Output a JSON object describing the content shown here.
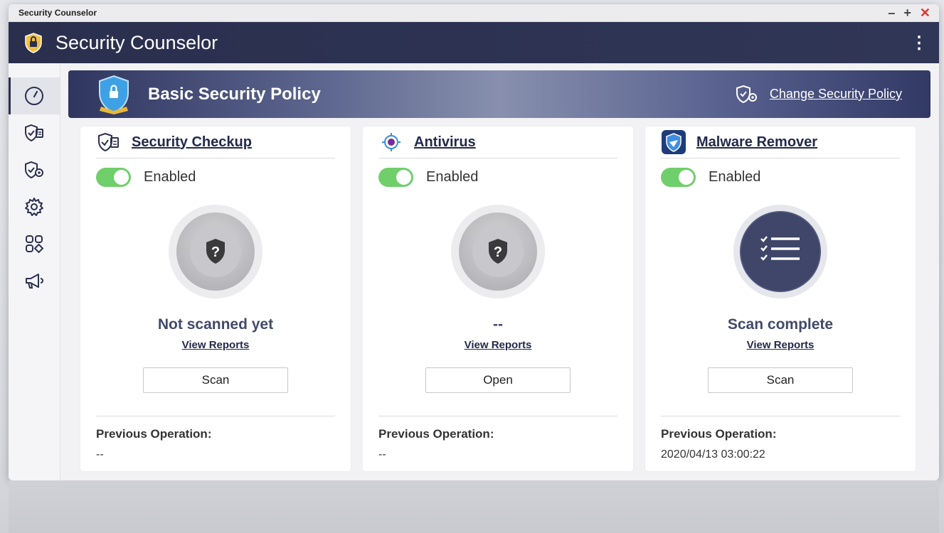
{
  "window": {
    "title": "Security Counselor",
    "minimize": "–",
    "maximize": "+",
    "close": "✕"
  },
  "app": {
    "title": "Security Counselor",
    "menu_glyph": "⋮"
  },
  "sidebar": {
    "items": [
      {
        "name": "dashboard",
        "icon": "gauge-icon",
        "active": true
      },
      {
        "name": "security-checkup",
        "icon": "shield-checklist-icon"
      },
      {
        "name": "security-policy",
        "icon": "shield-gear-icon"
      },
      {
        "name": "settings",
        "icon": "gear-icon"
      },
      {
        "name": "apps",
        "icon": "apps-grid-icon"
      },
      {
        "name": "announcements",
        "icon": "megaphone-icon"
      }
    ]
  },
  "banner": {
    "policy_title": "Basic Security Policy",
    "change_label": "Change Security Policy"
  },
  "cards": [
    {
      "title": "Security Checkup",
      "toggle_label": "Enabled",
      "status": "Not scanned yet",
      "view_reports": "View Reports",
      "action": "Scan",
      "prev_label": "Previous Operation:",
      "prev_value": "--"
    },
    {
      "title": "Antivirus",
      "toggle_label": "Enabled",
      "status": "--",
      "view_reports": "View Reports",
      "action": "Open",
      "prev_label": "Previous Operation:",
      "prev_value": "--"
    },
    {
      "title": "Malware Remover",
      "toggle_label": "Enabled",
      "status": "Scan complete",
      "view_reports": "View Reports",
      "action": "Scan",
      "prev_label": "Previous Operation:",
      "prev_value": "2020/04/13 03:00:22"
    }
  ],
  "colors": {
    "header": "#2b3050",
    "toggle_on": "#6fcf6a",
    "close": "#e0312d"
  }
}
